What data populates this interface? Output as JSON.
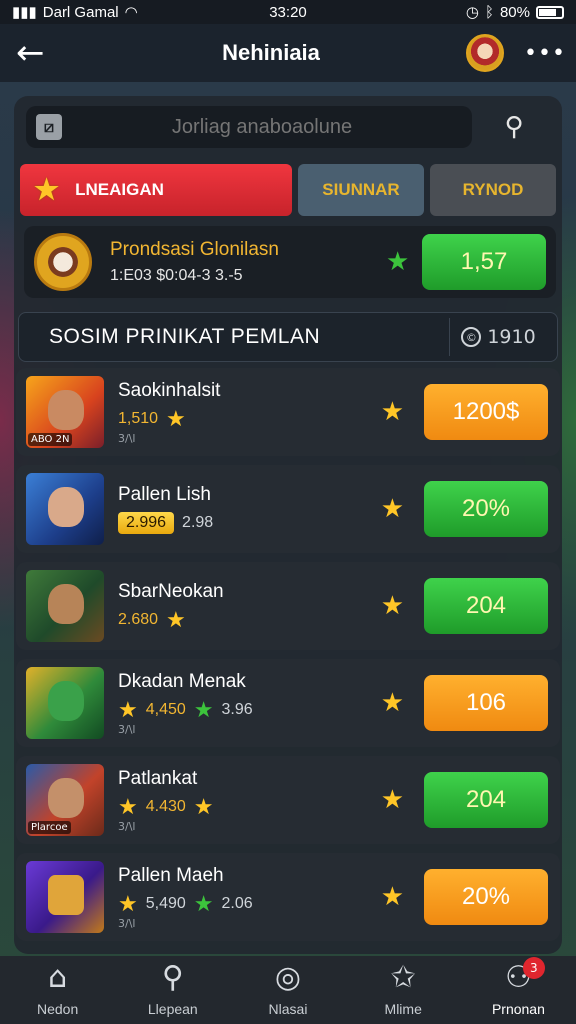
{
  "status_bar": {
    "carrier": "Darl Gamal",
    "time": "33:20",
    "battery": "80%"
  },
  "header": {
    "title": "Nehiniaia"
  },
  "search": {
    "placeholder": "Jorliag anaboaolune"
  },
  "tabs": [
    {
      "label": "LNEAIGAN"
    },
    {
      "label": "SIUNNAR"
    },
    {
      "label": "RYNOD"
    }
  ],
  "featured": {
    "name": "Prondsasi Glonilasn",
    "stats": "1:E03 $0:04-3 3.-5",
    "button": "1,57"
  },
  "section": {
    "title": "SOSIM PRINIKAT PEMLAN",
    "count": "1910"
  },
  "items": [
    {
      "name": "Saokinhalsit",
      "rating": "1,510",
      "rating2": "",
      "sub": "3/\\l",
      "tag": "ABO 2N",
      "button": "1200$",
      "button_color": "orange"
    },
    {
      "name": "Pallen Lish",
      "rating": "2.996",
      "rating2": "2.98",
      "sub": "",
      "tag": "",
      "button": "20%",
      "button_color": "green"
    },
    {
      "name": "SbarNeokan",
      "rating": "2.680",
      "rating2": "",
      "sub": "",
      "tag": "",
      "button": "204",
      "button_color": "green"
    },
    {
      "name": "Dkadan Menak",
      "rating": "4,450",
      "rating2": "3.96",
      "sub": "3/\\l",
      "tag": "",
      "button": "106",
      "button_color": "orange"
    },
    {
      "name": "Patlankat",
      "rating": "4.430",
      "rating2": "",
      "sub": "3/\\l",
      "tag": "Plarcoe",
      "button": "204",
      "button_color": "green"
    },
    {
      "name": "Pallen Maeh",
      "rating": "5,490",
      "rating2": "2.06",
      "sub": "3/\\l",
      "tag": "",
      "button": "20%",
      "button_color": "orange"
    }
  ],
  "bottom_nav": [
    {
      "label": "Nedon",
      "icon": "home-icon"
    },
    {
      "label": "Llepean",
      "icon": "search-icon"
    },
    {
      "label": "Nlasai",
      "icon": "controller-icon"
    },
    {
      "label": "Mlime",
      "icon": "star-icon"
    },
    {
      "label": "Prnonan",
      "icon": "profile-icon",
      "badge": "3"
    }
  ]
}
